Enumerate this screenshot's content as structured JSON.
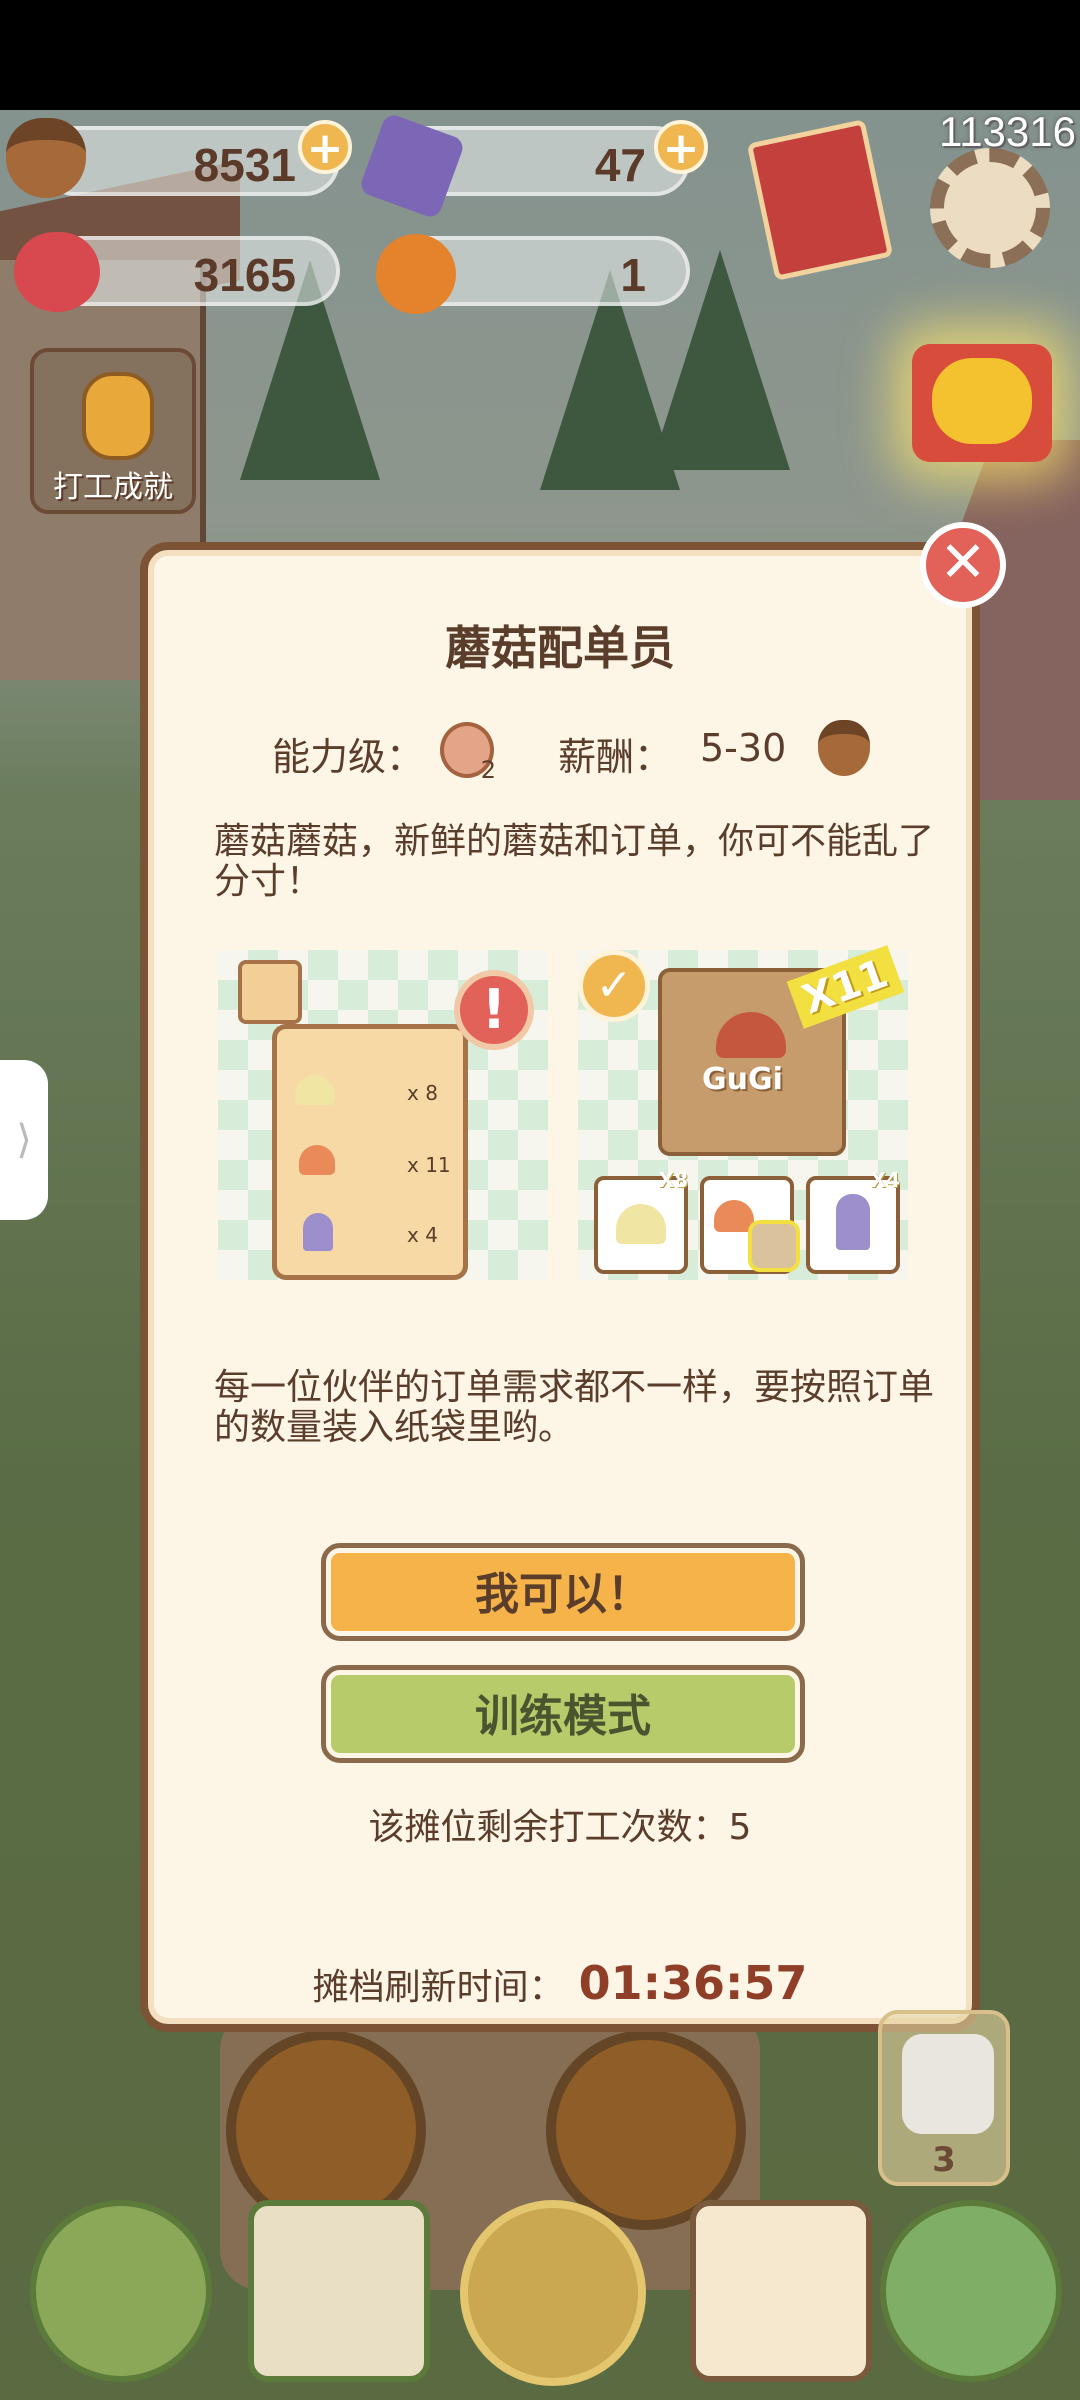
{
  "hud": {
    "acorns": "8531",
    "gems": "47",
    "hearts": "3165",
    "oranges": "1",
    "score": "113316"
  },
  "achievement": {
    "label": "打工成就"
  },
  "dialog": {
    "title": "蘑菇配单员",
    "ability_label": "能力级：",
    "ability_level": "2",
    "salary_label": "薪酬：",
    "salary_range": "5-30",
    "desc1": "蘑菇蘑菇，新鲜的蘑菇和订单，你可不能乱了分寸！",
    "left_order": [
      "x 8",
      "x 11",
      "x 4"
    ],
    "bag_label": "GuGi",
    "bag_count": "X11",
    "slot_counts": [
      "X8",
      "",
      "X4"
    ],
    "desc2": "每一位伙伴的订单需求都不一样，要按照订单的数量装入纸袋里哟。",
    "btn_yes": "我可以！",
    "btn_train": "训练模式",
    "remain": "该摊位剩余打工次数：5",
    "refresh_label": "摊档刷新时间：",
    "refresh_time": "01:36:57"
  },
  "gift_count": "3",
  "colors": {
    "accent": "#f5b34a",
    "train": "#b7cb6a",
    "close": "#e26158",
    "text": "#5a3d2b"
  }
}
